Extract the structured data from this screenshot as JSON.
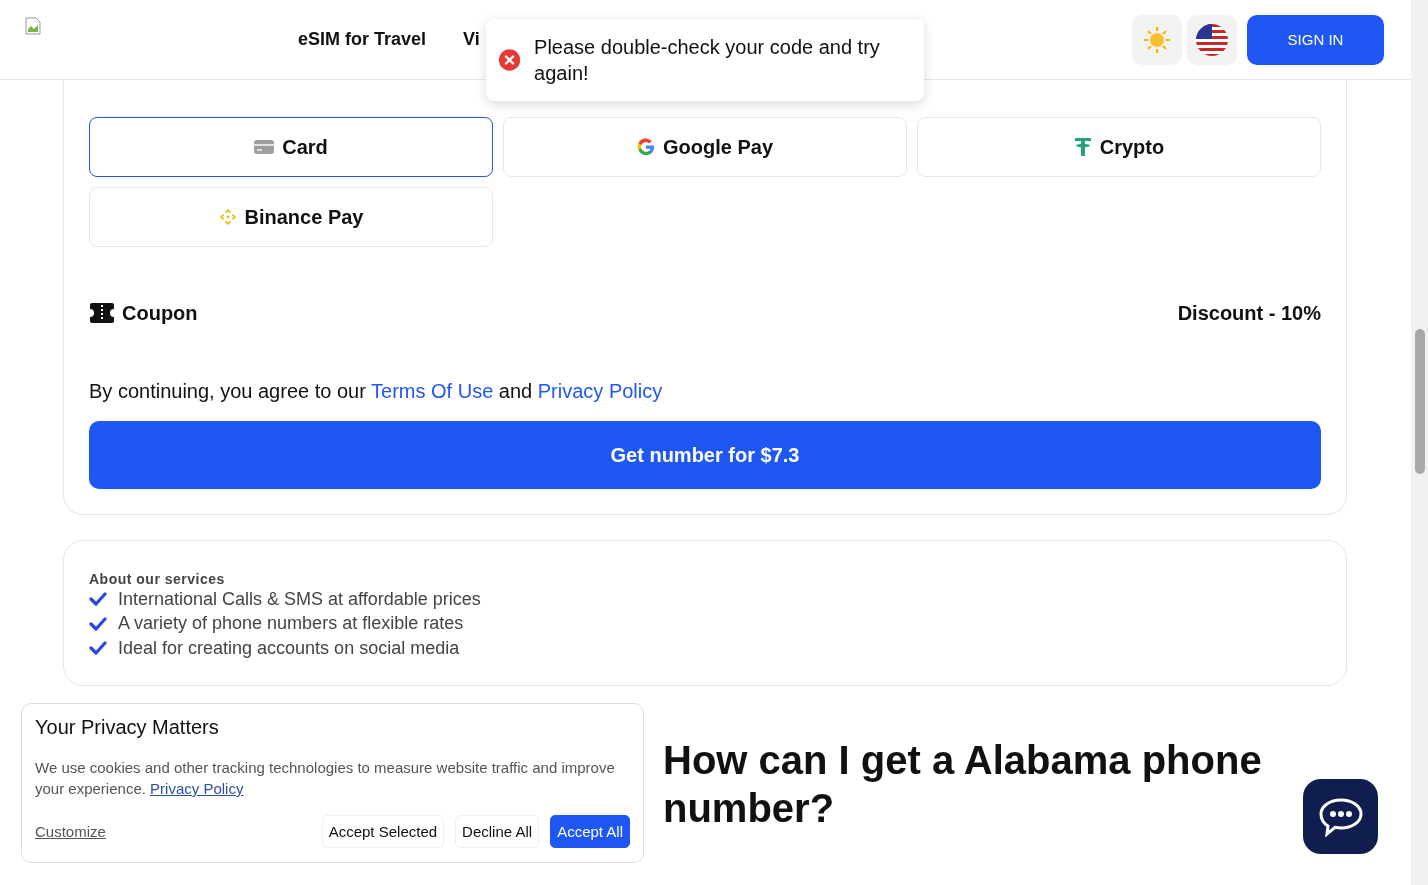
{
  "header": {
    "nav": [
      {
        "label": "eSIM for Travel"
      },
      {
        "label": "Vi"
      }
    ],
    "sign_in": "SIGN IN"
  },
  "toast": {
    "kind": "error",
    "message": "Please double-check your code and try again!"
  },
  "payment_methods": [
    {
      "label": "Card",
      "selected": true
    },
    {
      "label": "Google Pay",
      "selected": false
    },
    {
      "label": "Crypto",
      "selected": false
    },
    {
      "label": "Binance Pay",
      "selected": false
    }
  ],
  "coupon": {
    "label": "Coupon",
    "discount": "Discount - 10%"
  },
  "terms": {
    "prefix": "By continuing, you agree to our",
    "link_1": "Terms Of Use",
    "joiner": "and",
    "link_2": "Privacy Policy"
  },
  "cta": "Get number for $7.3",
  "services": {
    "title": "About our services",
    "items": [
      "International Calls & SMS at affordable prices",
      "A variety of phone numbers at flexible rates",
      "Ideal for creating accounts on social media"
    ]
  },
  "heading": "How can I get a Alabama phone number?",
  "cookie_banner": {
    "title": "Your Privacy Matters",
    "text": "We use cookies and other tracking technologies to measure website traffic and improve your experience.",
    "link": "Privacy Policy",
    "customize": "Customize",
    "buttons": [
      {
        "label": "Accept Selected",
        "primary": false
      },
      {
        "label": "Decline All",
        "primary": false
      },
      {
        "label": "Accept All",
        "primary": true
      }
    ]
  }
}
